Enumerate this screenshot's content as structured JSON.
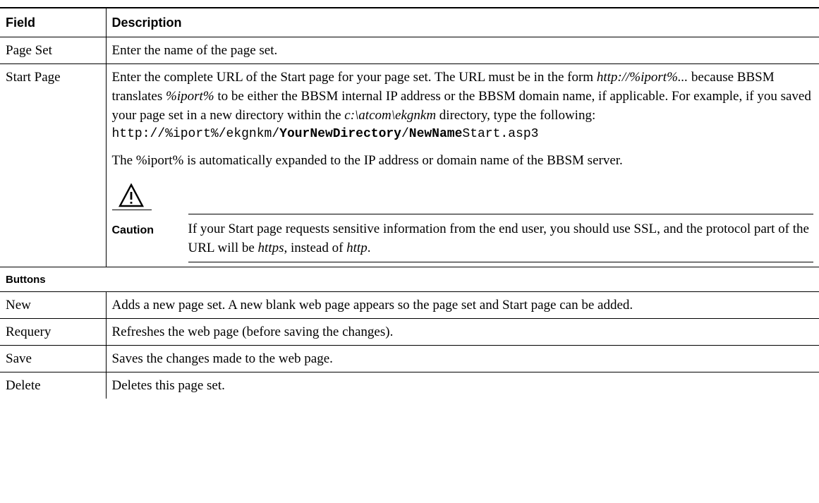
{
  "header": {
    "field": "Field",
    "description": "Description"
  },
  "rows": [
    {
      "field": "Page Set",
      "desc": "Enter the name of the page set."
    },
    {
      "field": "Start Page",
      "p1": {
        "a": "Enter the complete URL of the Start page for your page set. The URL must be in the form ",
        "b": "http://%iport%...",
        "c": " because BBSM translates ",
        "d": "%iport%",
        "e": " to be either the BBSM internal IP address or the BBSM domain name, if applicable. For example, if you saved your page set in a new directory within the ",
        "f": "c:\\atcom\\ekgnkm",
        "g": " directory, type the following:"
      },
      "url": {
        "a": "http://%iport%/ekgnkm/",
        "b": "YourNewDirectory",
        "c": "/",
        "d": "NewName",
        "e": "Start.asp3"
      },
      "p2": "The %iport% is automatically expanded to the IP address or domain name of the BBSM server.",
      "caution": {
        "label": "Caution",
        "a": "If your Start page requests sensitive information from the end user, you should use SSL, and the protocol part of the URL will be ",
        "b": "https",
        "c": ", instead of ",
        "d": "http",
        "e": "."
      }
    }
  ],
  "buttons_section": "Buttons",
  "buttons": [
    {
      "field": "New",
      "desc": "Adds a new page set. A new blank web page appears so the page set and Start page can be added."
    },
    {
      "field": "Requery",
      "desc": "Refreshes the web page (before saving the changes)."
    },
    {
      "field": "Save",
      "desc": "Saves the changes made to the web page."
    },
    {
      "field": "Delete",
      "desc": "Deletes this page set."
    }
  ],
  "icons": {
    "caution": "warning-triangle-icon"
  }
}
